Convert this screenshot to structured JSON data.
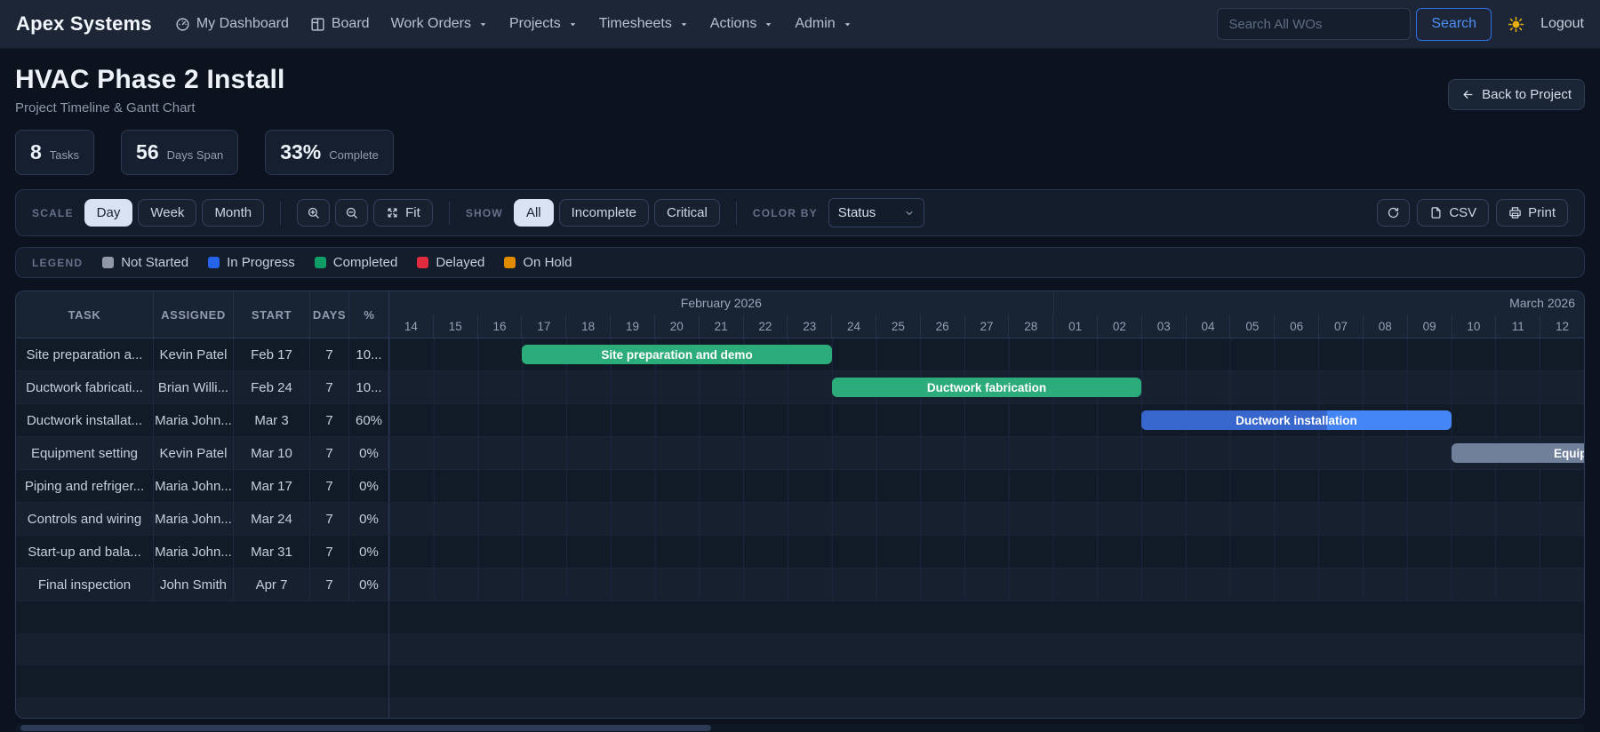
{
  "navbar": {
    "brand": "Apex Systems",
    "items": [
      {
        "label": "My Dashboard",
        "icon": "speedometer-icon",
        "caret": false
      },
      {
        "label": "Board",
        "icon": "kanban-icon",
        "caret": false
      },
      {
        "label": "Work Orders",
        "caret": true
      },
      {
        "label": "Projects",
        "caret": true
      },
      {
        "label": "Timesheets",
        "caret": true
      },
      {
        "label": "Actions",
        "caret": true
      },
      {
        "label": "Admin",
        "caret": true
      }
    ],
    "search_placeholder": "Search All WOs",
    "search_button": "Search",
    "logout": "Logout"
  },
  "header": {
    "title": "HVAC Phase 2 Install",
    "subtitle": "Project Timeline & Gantt Chart",
    "back_label": "Back to Project"
  },
  "stats": [
    {
      "value": "8",
      "label": "Tasks"
    },
    {
      "value": "56",
      "label": "Days Span"
    },
    {
      "value": "33%",
      "label": "Complete"
    }
  ],
  "toolbar": {
    "scale_label": "SCALE",
    "scale_options": [
      "Day",
      "Week",
      "Month"
    ],
    "scale_active": "Day",
    "fit_label": "Fit",
    "show_label": "SHOW",
    "show_options": [
      "All",
      "Incomplete",
      "Critical"
    ],
    "show_active": "All",
    "color_by_label": "COLOR BY",
    "color_by_value": "Status",
    "csv_label": "CSV",
    "print_label": "Print"
  },
  "legend": {
    "label": "LEGEND",
    "items": [
      {
        "label": "Not Started",
        "color": "#9199a6"
      },
      {
        "label": "In Progress",
        "color": "#2563eb"
      },
      {
        "label": "Completed",
        "color": "#0f9d68"
      },
      {
        "label": "Delayed",
        "color": "#df2c3f"
      },
      {
        "label": "On Hold",
        "color": "#e28b00"
      }
    ]
  },
  "gantt": {
    "columns": [
      "TASK",
      "ASSIGNED",
      "START",
      "DAYS",
      "%"
    ],
    "months": [
      {
        "label": "February 2026",
        "days": [
          "14",
          "15",
          "16",
          "17",
          "18",
          "19",
          "20",
          "21",
          "22",
          "23",
          "24",
          "25",
          "26",
          "27",
          "28"
        ]
      },
      {
        "label": "March 2026",
        "days": [
          "01",
          "02",
          "03",
          "04",
          "05",
          "06",
          "07",
          "08",
          "09",
          "10",
          "11",
          "12"
        ]
      }
    ],
    "total_days": 27,
    "tasks": [
      {
        "name": "Site preparation a...",
        "assigned": "Kevin Patel",
        "start": "Feb 17",
        "days": "7",
        "pct": "10...",
        "bar": {
          "label": "Site preparation and demo",
          "offset": 3,
          "span": 7,
          "color": "#2cab7b",
          "progress": null
        }
      },
      {
        "name": "Ductwork fabricati...",
        "assigned": "Brian Willi...",
        "start": "Feb 24",
        "days": "7",
        "pct": "10...",
        "bar": {
          "label": "Ductwork fabrication",
          "offset": 10,
          "span": 7,
          "color": "#2cab7b",
          "progress": null
        }
      },
      {
        "name": "Ductwork installat...",
        "assigned": "Maria John...",
        "start": "Mar 3",
        "days": "7",
        "pct": "60%",
        "bar": {
          "label": "Ductwork installation",
          "offset": 17,
          "span": 7,
          "color": "#4486f5",
          "progress": 60,
          "progress_color": "#3767cd"
        }
      },
      {
        "name": "Equipment setting",
        "assigned": "Kevin Patel",
        "start": "Mar 10",
        "days": "7",
        "pct": "0%",
        "bar": {
          "label": "Equipment setting",
          "offset": 24,
          "span": 7,
          "color": "#70809b",
          "progress": null
        }
      },
      {
        "name": "Piping and refriger...",
        "assigned": "Maria John...",
        "start": "Mar 17",
        "days": "7",
        "pct": "0%",
        "bar": {
          "label": "",
          "offset": 31,
          "span": 7,
          "color": "#70809b",
          "progress": null
        }
      },
      {
        "name": "Controls and wiring",
        "assigned": "Maria John...",
        "start": "Mar 24",
        "days": "7",
        "pct": "0%",
        "bar": {
          "label": "",
          "offset": 38,
          "span": 7,
          "color": "#70809b",
          "progress": null
        }
      },
      {
        "name": "Start-up and bala...",
        "assigned": "Maria John...",
        "start": "Mar 31",
        "days": "7",
        "pct": "0%",
        "bar": {
          "label": "",
          "offset": 45,
          "span": 7,
          "color": "#70809b",
          "progress": null
        }
      },
      {
        "name": "Final inspection",
        "assigned": "John Smith",
        "start": "Apr 7",
        "days": "7",
        "pct": "0%",
        "bar": {
          "label": "",
          "offset": 52,
          "span": 7,
          "color": "#70809b",
          "progress": null
        }
      }
    ],
    "empty_rows": 4
  },
  "colors": {
    "accent": "#3b82f6"
  }
}
